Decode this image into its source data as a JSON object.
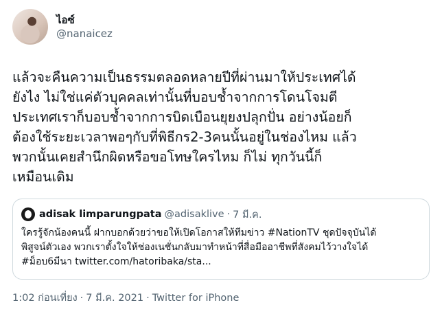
{
  "author": {
    "display_name": "ไอซ์",
    "handle": "@nanaicez",
    "avatar_icon": "profile-photo"
  },
  "tweet": {
    "text": "แล้วจะคืนความเป็นธรรมตลอดหลายปีที่ผ่านมาให้ประเทศได้\nยังไง ไม่ใช่แค่ตัวบุคคลเท่านั้นที่บอบช้ำจากการโดนโจมตี\nประเทศเราก็บอบช้ำจากการบิดเบือนยุยงปลุกปั่น อย่างน้อยก็\nต้องใช้ระยะเวลาพอๆกับที่พิธีกร2-3คนนั้นอยู่ในช่องไหม แล้ว\nพวกนั้นเคยสำนึกผิดหรือขอโทษใครไหม ก็ไม่ ทุกวันนี้ก็\nเหมือนเดิม"
  },
  "quoted": {
    "name": "adisak limparungpata",
    "handle": "@adisaklive",
    "dot": "·",
    "date": "7 มี.ค.",
    "text": "ใครรู้จักน้องคนนี้ ฝากบอกด้วยว่าขอให้เปิดโอกาสให้ทีมข่าว #NationTV ชุดปัจจุบันได้\nพิสูจน์ตัวเอง พวกเราตั้งใจให้ช่องเนชั่นกลับมาทำหน้าที่สื่อมืออาชีพที่สังคมไว้วางใจได้\n#ม็อบ6มีนา twitter.com/hatoribaka/sta..."
  },
  "footer": {
    "time": "1:02 ก่อนเที่ยง",
    "sep": "·",
    "date": "7 มี.ค. 2021",
    "sep2": "·",
    "source": "Twitter for iPhone"
  },
  "colors": {
    "text": "#0f1419",
    "muted": "#536471",
    "border": "#cfd9de"
  }
}
